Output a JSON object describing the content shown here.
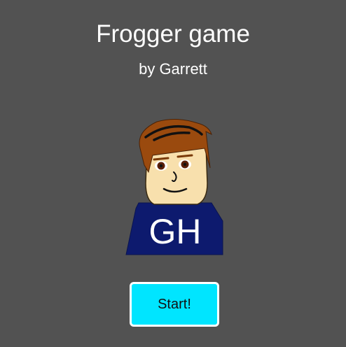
{
  "title": "Frogger game",
  "subtitle": "by Garrett",
  "avatar": {
    "shirt_initials": "GH",
    "colors": {
      "hair": "#9a4a0e",
      "skin": "#f8e0ad",
      "shirt": "#0d1a6e",
      "eyes": "#5a1f0a"
    }
  },
  "start_button": {
    "label": "Start!",
    "background": "#00e5ff"
  },
  "colors": {
    "background": "#525252",
    "text": "#ffffff"
  }
}
